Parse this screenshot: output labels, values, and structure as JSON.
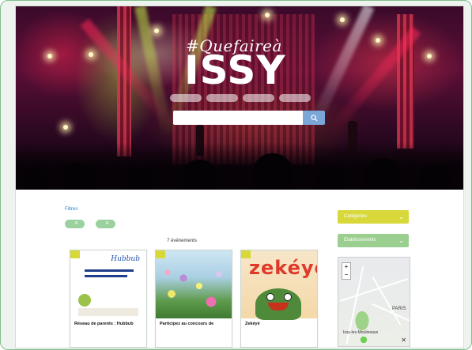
{
  "hero": {
    "hashtag": "#Quefaireà",
    "city": "ISSY",
    "chips": [
      "",
      "",
      "",
      ""
    ],
    "search_placeholder": ""
  },
  "filters": {
    "label": "Filtres",
    "active": [
      {
        "label": "",
        "removable": true
      },
      {
        "label": "",
        "removable": true
      }
    ]
  },
  "results_count_text": "7 événements",
  "cards": [
    {
      "badge": "",
      "image_logo": "Hubbub",
      "title": "Réseau de parents : Hubbub",
      "subtitle": ""
    },
    {
      "badge": "",
      "title": "Participez au concours de",
      "subtitle": ""
    },
    {
      "badge": "",
      "image_title": "zekéyé",
      "title": "Zekéyé",
      "subtitle": ""
    }
  ],
  "sidebar": {
    "category_label": "Catégories",
    "establishment_label": "Etablissements",
    "map": {
      "city_label": "PARIS",
      "issy_label": "Issy-les-Moulineaux",
      "zoom_in": "+",
      "zoom_out": "−",
      "close": "✕"
    }
  },
  "colors": {
    "accent_green": "#9bd19f",
    "accent_yellow": "#d8d83a",
    "link_blue": "#2a7fbf",
    "search_button": "#7aa6d8"
  }
}
